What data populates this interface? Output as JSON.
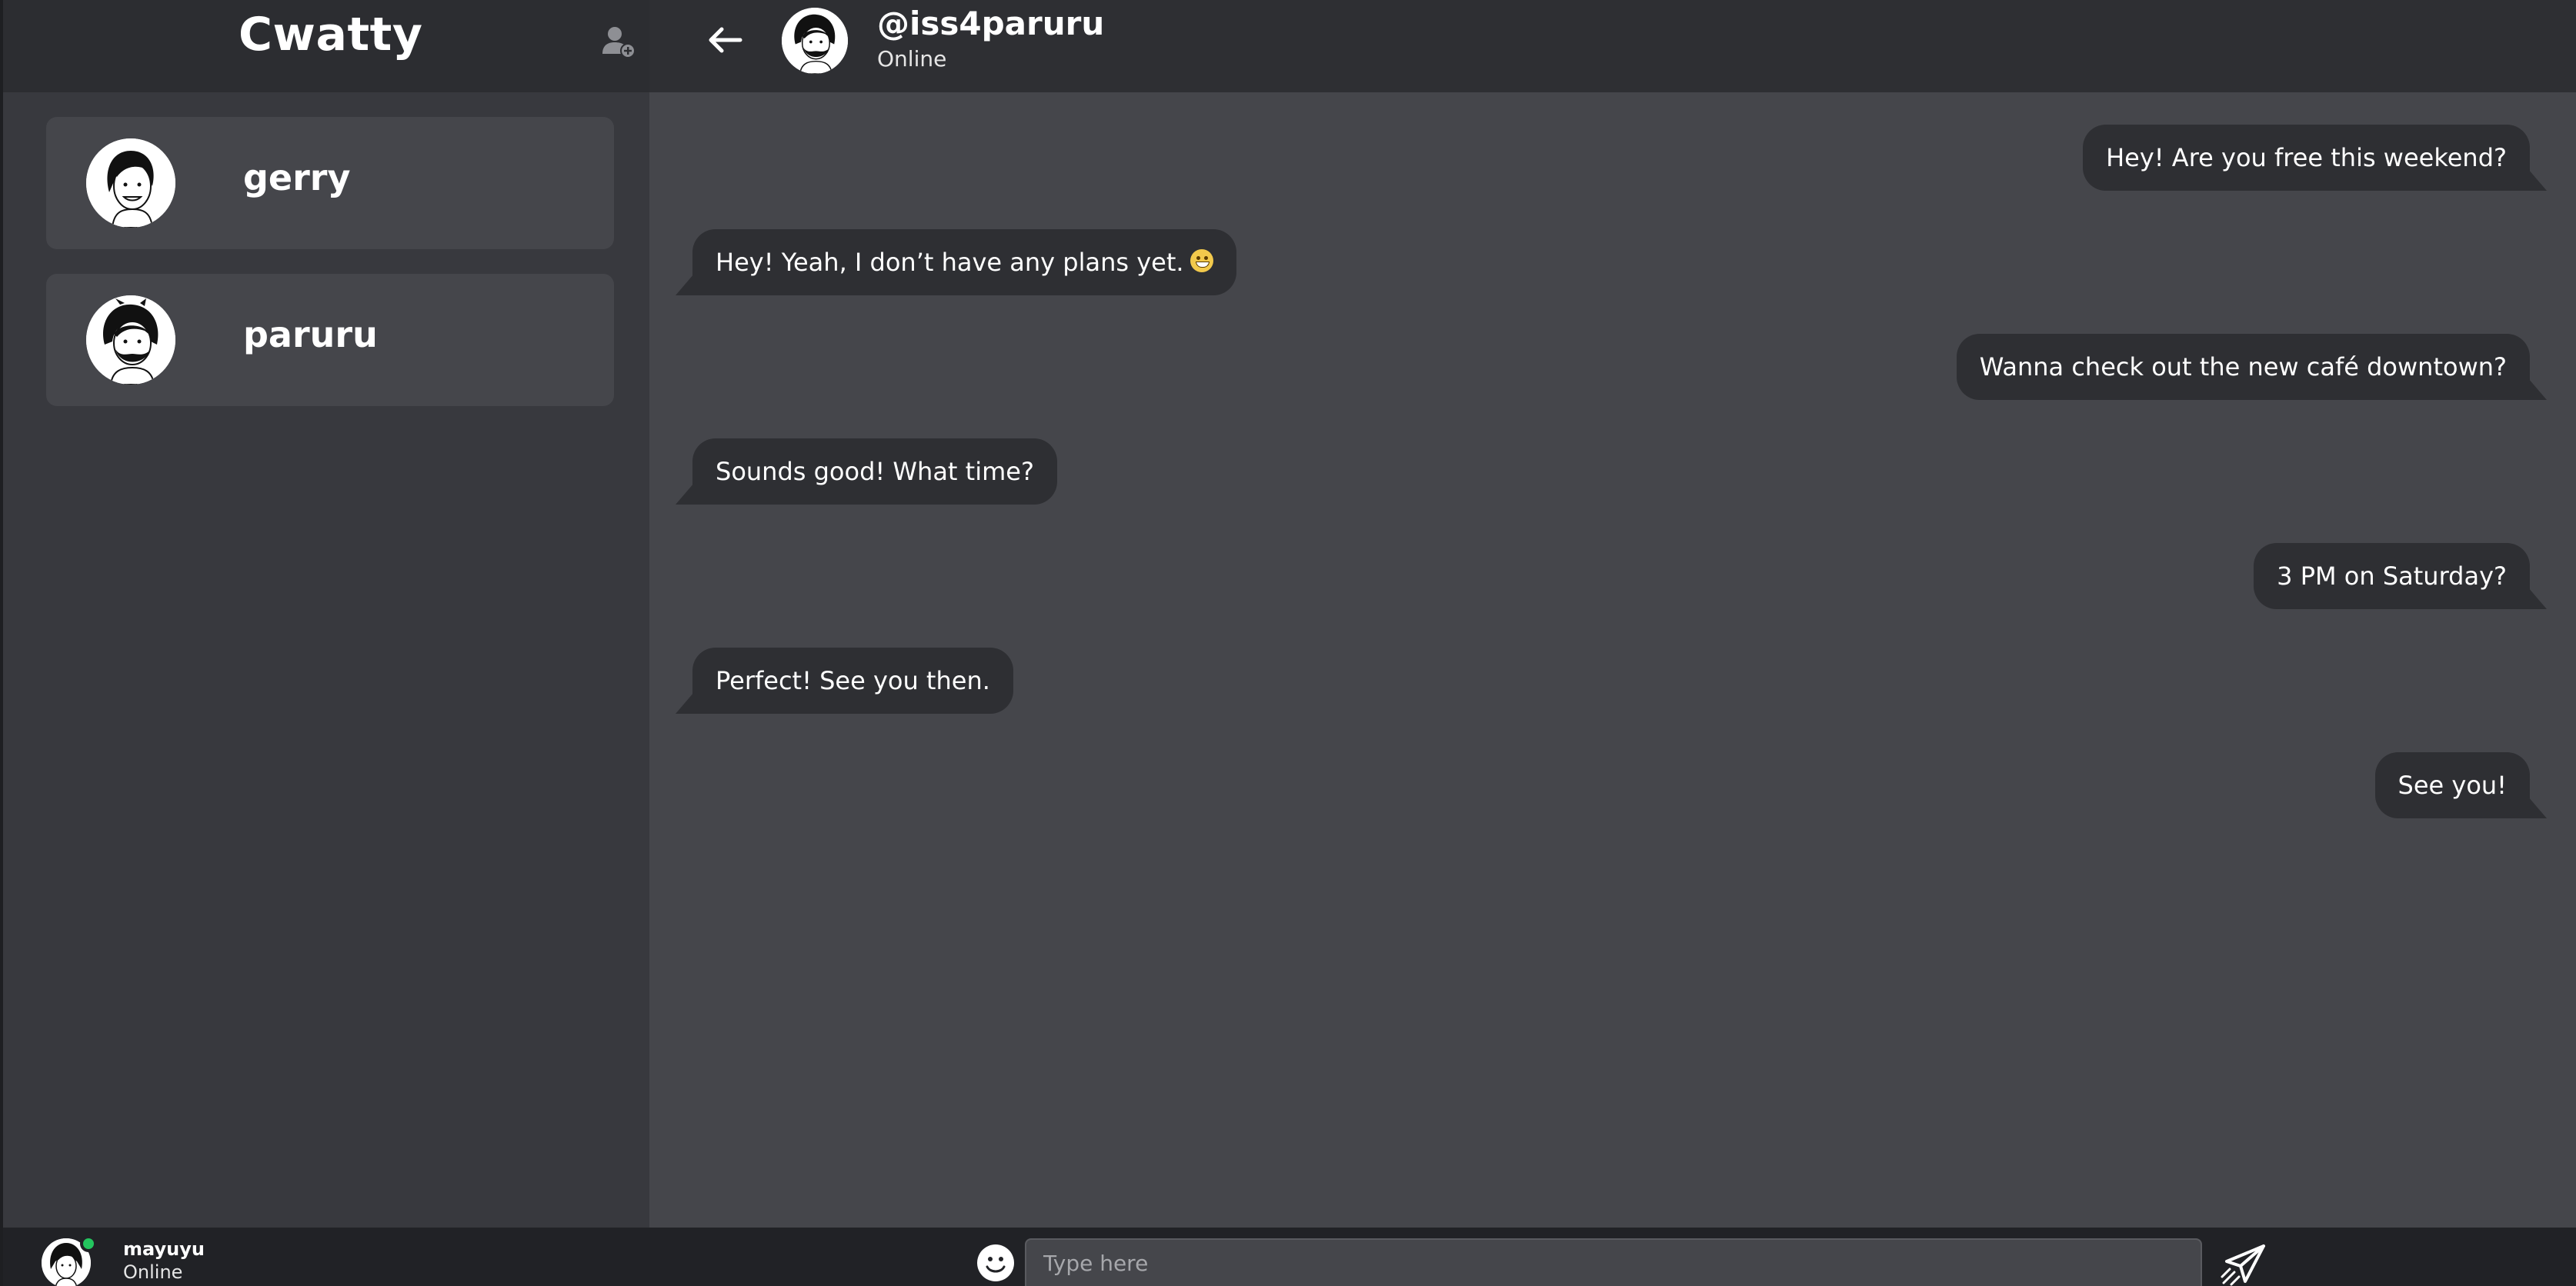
{
  "app": {
    "title": "Cwatty"
  },
  "sidebar": {
    "contacts": [
      {
        "name": "gerry"
      },
      {
        "name": "paruru"
      }
    ]
  },
  "current_user": {
    "name": "mayuyu",
    "status": "Online"
  },
  "chat": {
    "handle": "@iss4paruru",
    "status": "Online",
    "messages": [
      {
        "direction": "out",
        "text": "Hey! Are you free this weekend?"
      },
      {
        "direction": "in",
        "text": "Hey! Yeah, I don’t have any plans yet.",
        "emoji": "grinning-face"
      },
      {
        "direction": "out",
        "text": "Wanna check out the new café downtown?"
      },
      {
        "direction": "in",
        "text": "Sounds good! What time?"
      },
      {
        "direction": "out",
        "text": "3 PM on Saturday?"
      },
      {
        "direction": "in",
        "text": "Perfect! See you then."
      },
      {
        "direction": "out",
        "text": "See you!"
      }
    ]
  },
  "composer": {
    "placeholder": "Type here"
  },
  "icons": {
    "add_user": "add-user-icon",
    "back": "arrow-left-icon",
    "emoji": "emoji-icon",
    "send": "send-icon"
  },
  "colors": {
    "status_online": "#23c55e",
    "bubble": "#2e2f33",
    "chat_bg": "#45464b",
    "sidebar_bg": "#38393e"
  }
}
